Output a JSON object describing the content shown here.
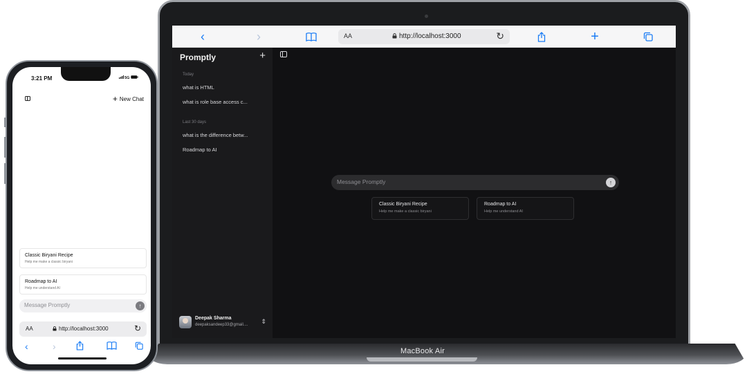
{
  "laptop": {
    "base_label": "MacBook Air",
    "safari": {
      "back_icon": "chevron-left-icon",
      "forward_icon": "chevron-right-icon",
      "bookmarks_icon": "book-icon",
      "text_size_label": "AA",
      "url": "http://localhost:3000",
      "reload_icon": "reload-icon",
      "share_icon": "share-icon",
      "new_tab_icon": "plus-icon",
      "tabs_icon": "tabs-icon"
    },
    "sidebar": {
      "brand": "Promptly",
      "sections": [
        {
          "label": "Today",
          "items": [
            "what is HTML",
            "what is role base access c..."
          ]
        },
        {
          "label": "Last 30 days",
          "items": [
            "what is the difference betw...",
            "Roadmap to AI"
          ]
        }
      ],
      "user": {
        "name": "Deepak Sharma",
        "email": "deepaksandeep33@gmail...."
      }
    },
    "main": {
      "message_placeholder": "Message Promptly",
      "suggestions": [
        {
          "title": "Classic Biryani Recipe",
          "subtitle": "Help me make a classic biryani"
        },
        {
          "title": "Roadmap to AI",
          "subtitle": "Help me understand AI"
        }
      ]
    }
  },
  "phone": {
    "time": "3:21 PM",
    "status": "5G",
    "new_chat_label": "New Chat",
    "suggestions": [
      {
        "title": "Classic Biryani Recipe",
        "subtitle": "Help me make a classic biryani"
      },
      {
        "title": "Roadmap to AI",
        "subtitle": "Help me understand AI"
      }
    ],
    "message_placeholder": "Message Promptly",
    "safari": {
      "text_size_label": "AA",
      "url": "http://localhost:3000"
    }
  },
  "colors": {
    "accent": "#1a7cf5",
    "dark_bg": "#111113",
    "sidebar_bg": "#1a1a1c"
  }
}
